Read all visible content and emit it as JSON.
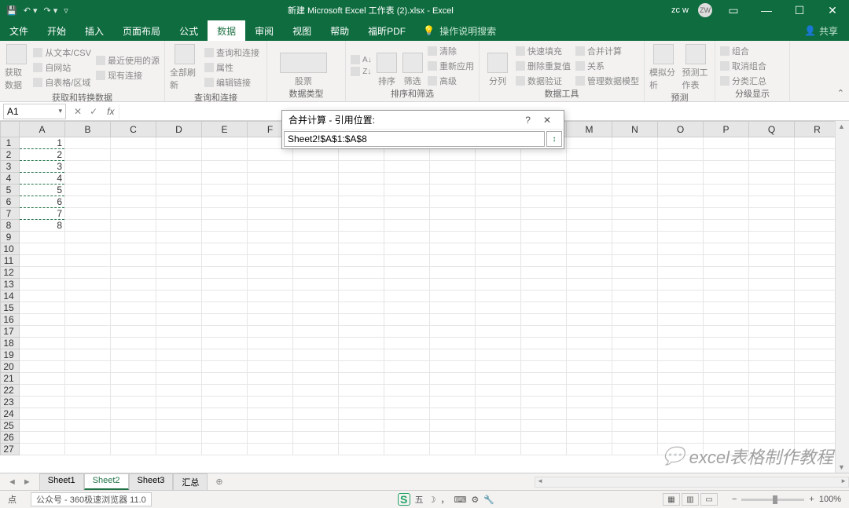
{
  "titlebar": {
    "title": "新建 Microsoft Excel 工作表 (2).xlsx - Excel",
    "user": "zc w",
    "avatar": "ZW"
  },
  "tabs": {
    "file": "文件",
    "items": [
      "开始",
      "插入",
      "页面布局",
      "公式",
      "数据",
      "审阅",
      "视图",
      "帮助",
      "福昕PDF"
    ],
    "active_index": 4,
    "tellme": "操作说明搜索",
    "share": "共享"
  },
  "ribbon": {
    "g1_big": "获取数据",
    "g1_items": [
      "从文本/CSV",
      "自网站",
      "自表格/区域",
      "最近使用的源",
      "现有连接"
    ],
    "g1_label": "获取和转换数据",
    "g2_big": "全部刷新",
    "g2_items": [
      "查询和连接",
      "属性",
      "编辑链接"
    ],
    "g2_label": "查询和连接",
    "g3_big": "股票",
    "g3_label": "数据类型",
    "g4_big": "排序",
    "g4_big2": "筛选",
    "g4_items": [
      "清除",
      "重新应用",
      "高级"
    ],
    "g4_label": "排序和筛选",
    "g5_big": "分列",
    "g5_items": [
      "快速填充",
      "删除重复值",
      "数据验证",
      "合并计算",
      "关系",
      "管理数据模型"
    ],
    "g5_label": "数据工具",
    "g6_big1": "模拟分析",
    "g6_big2": "预测工作表",
    "g6_label": "预测",
    "g7_items": [
      "组合",
      "取消组合",
      "分类汇总"
    ],
    "g7_label": "分级显示"
  },
  "formula_bar": {
    "name": "A1",
    "fx": ""
  },
  "dialog": {
    "title": "合并计算 - 引用位置:",
    "value": "Sheet2!$A$1:$A$8",
    "help": "?",
    "close": "✕"
  },
  "grid": {
    "cols": [
      "A",
      "B",
      "C",
      "D",
      "E",
      "F",
      "G",
      "H",
      "I",
      "J",
      "K",
      "L",
      "M",
      "N",
      "O",
      "P",
      "Q",
      "R"
    ],
    "rows": 27,
    "data_col_A": [
      "1",
      "2",
      "3",
      "4",
      "5",
      "6",
      "7",
      "8"
    ]
  },
  "sheets": {
    "tabs": [
      "Sheet1",
      "Sheet2",
      "Sheet3",
      "汇总"
    ],
    "active_index": 1
  },
  "status": {
    "mode": "点",
    "info": "公众号 - 360极速浏览器 11.0",
    "ime": "五",
    "zoom": "100%"
  },
  "watermark": "excel表格制作教程"
}
